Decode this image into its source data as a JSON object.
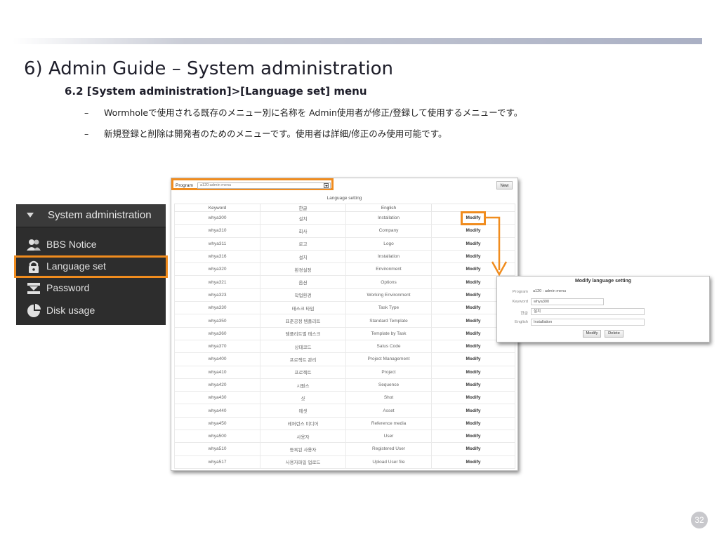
{
  "slide": {
    "title": "6) Admin Guide – System administration",
    "subtitle": "6.2 [System administration]>[Language set] menu",
    "bullets": [
      "Wormholeで使用される既存のメニュー別に名称を Admin使用者が修正/登録して使用するメニューです。",
      "新規登録と削除は開発者のためのメニューです。使用者は詳細/修正のみ使用可能です。"
    ],
    "bullet_dash": "–",
    "page_number": "32"
  },
  "sidebar": {
    "header": "System administration",
    "items": [
      {
        "label": "BBS Notice",
        "icon": "users-icon"
      },
      {
        "label": "Language set",
        "icon": "lock-icon",
        "active": true
      },
      {
        "label": "Password",
        "icon": "password-icon"
      },
      {
        "label": "Disk usage",
        "icon": "pie-chart-icon"
      }
    ]
  },
  "panel": {
    "program_label": "Program",
    "program_value": "a120:admin menu",
    "new_label": "New",
    "table_title": "Language setting",
    "columns": [
      "Keyword",
      "한글",
      "English",
      ""
    ],
    "modify_label": "Modify",
    "rows": [
      [
        "whya300",
        "설치",
        "Installation"
      ],
      [
        "whya310",
        "회사",
        "Company"
      ],
      [
        "whya311",
        "로고",
        "Logo"
      ],
      [
        "whya316",
        "설치",
        "Installation"
      ],
      [
        "whya320",
        "환경설정",
        "Environment"
      ],
      [
        "whya321",
        "옵션",
        "Options"
      ],
      [
        "whya323",
        "작업환경",
        "Working Environment"
      ],
      [
        "whya330",
        "태스크 타입",
        "Task Type"
      ],
      [
        "whya350",
        "표준공정 템플리트",
        "Standard Template"
      ],
      [
        "whya360",
        "템플리트별 태스크",
        "Template by Task"
      ],
      [
        "whya370",
        "상태코드",
        "Satus Code"
      ],
      [
        "whya400",
        "프로젝트 관리",
        "Project Management"
      ],
      [
        "whya410",
        "프로젝트",
        "Project"
      ],
      [
        "whya420",
        "시퀀스",
        "Sequence"
      ],
      [
        "whya430",
        "샷",
        "Shot"
      ],
      [
        "whya440",
        "에셋",
        "Asset"
      ],
      [
        "whya450",
        "레퍼런스 미디어",
        "Reference media"
      ],
      [
        "whya500",
        "사용자",
        "User"
      ],
      [
        "whya510",
        "등록된 사용자",
        "Registered User"
      ],
      [
        "whya517",
        "사용자파일 업로드",
        "Upload User file"
      ]
    ]
  },
  "popup": {
    "title": "Modify language setting",
    "fields": [
      {
        "label": "Program",
        "value": "a120 : admin menu"
      },
      {
        "label": "Keyword",
        "value": "whya300"
      },
      {
        "label": "한글",
        "value": "설치"
      },
      {
        "label": "English",
        "value": "Installation"
      }
    ],
    "modify_label": "Modify",
    "delete_label": "Delete"
  },
  "colors": {
    "highlight": "#f08c1e",
    "sidebar_bg": "#2d2d2d"
  }
}
